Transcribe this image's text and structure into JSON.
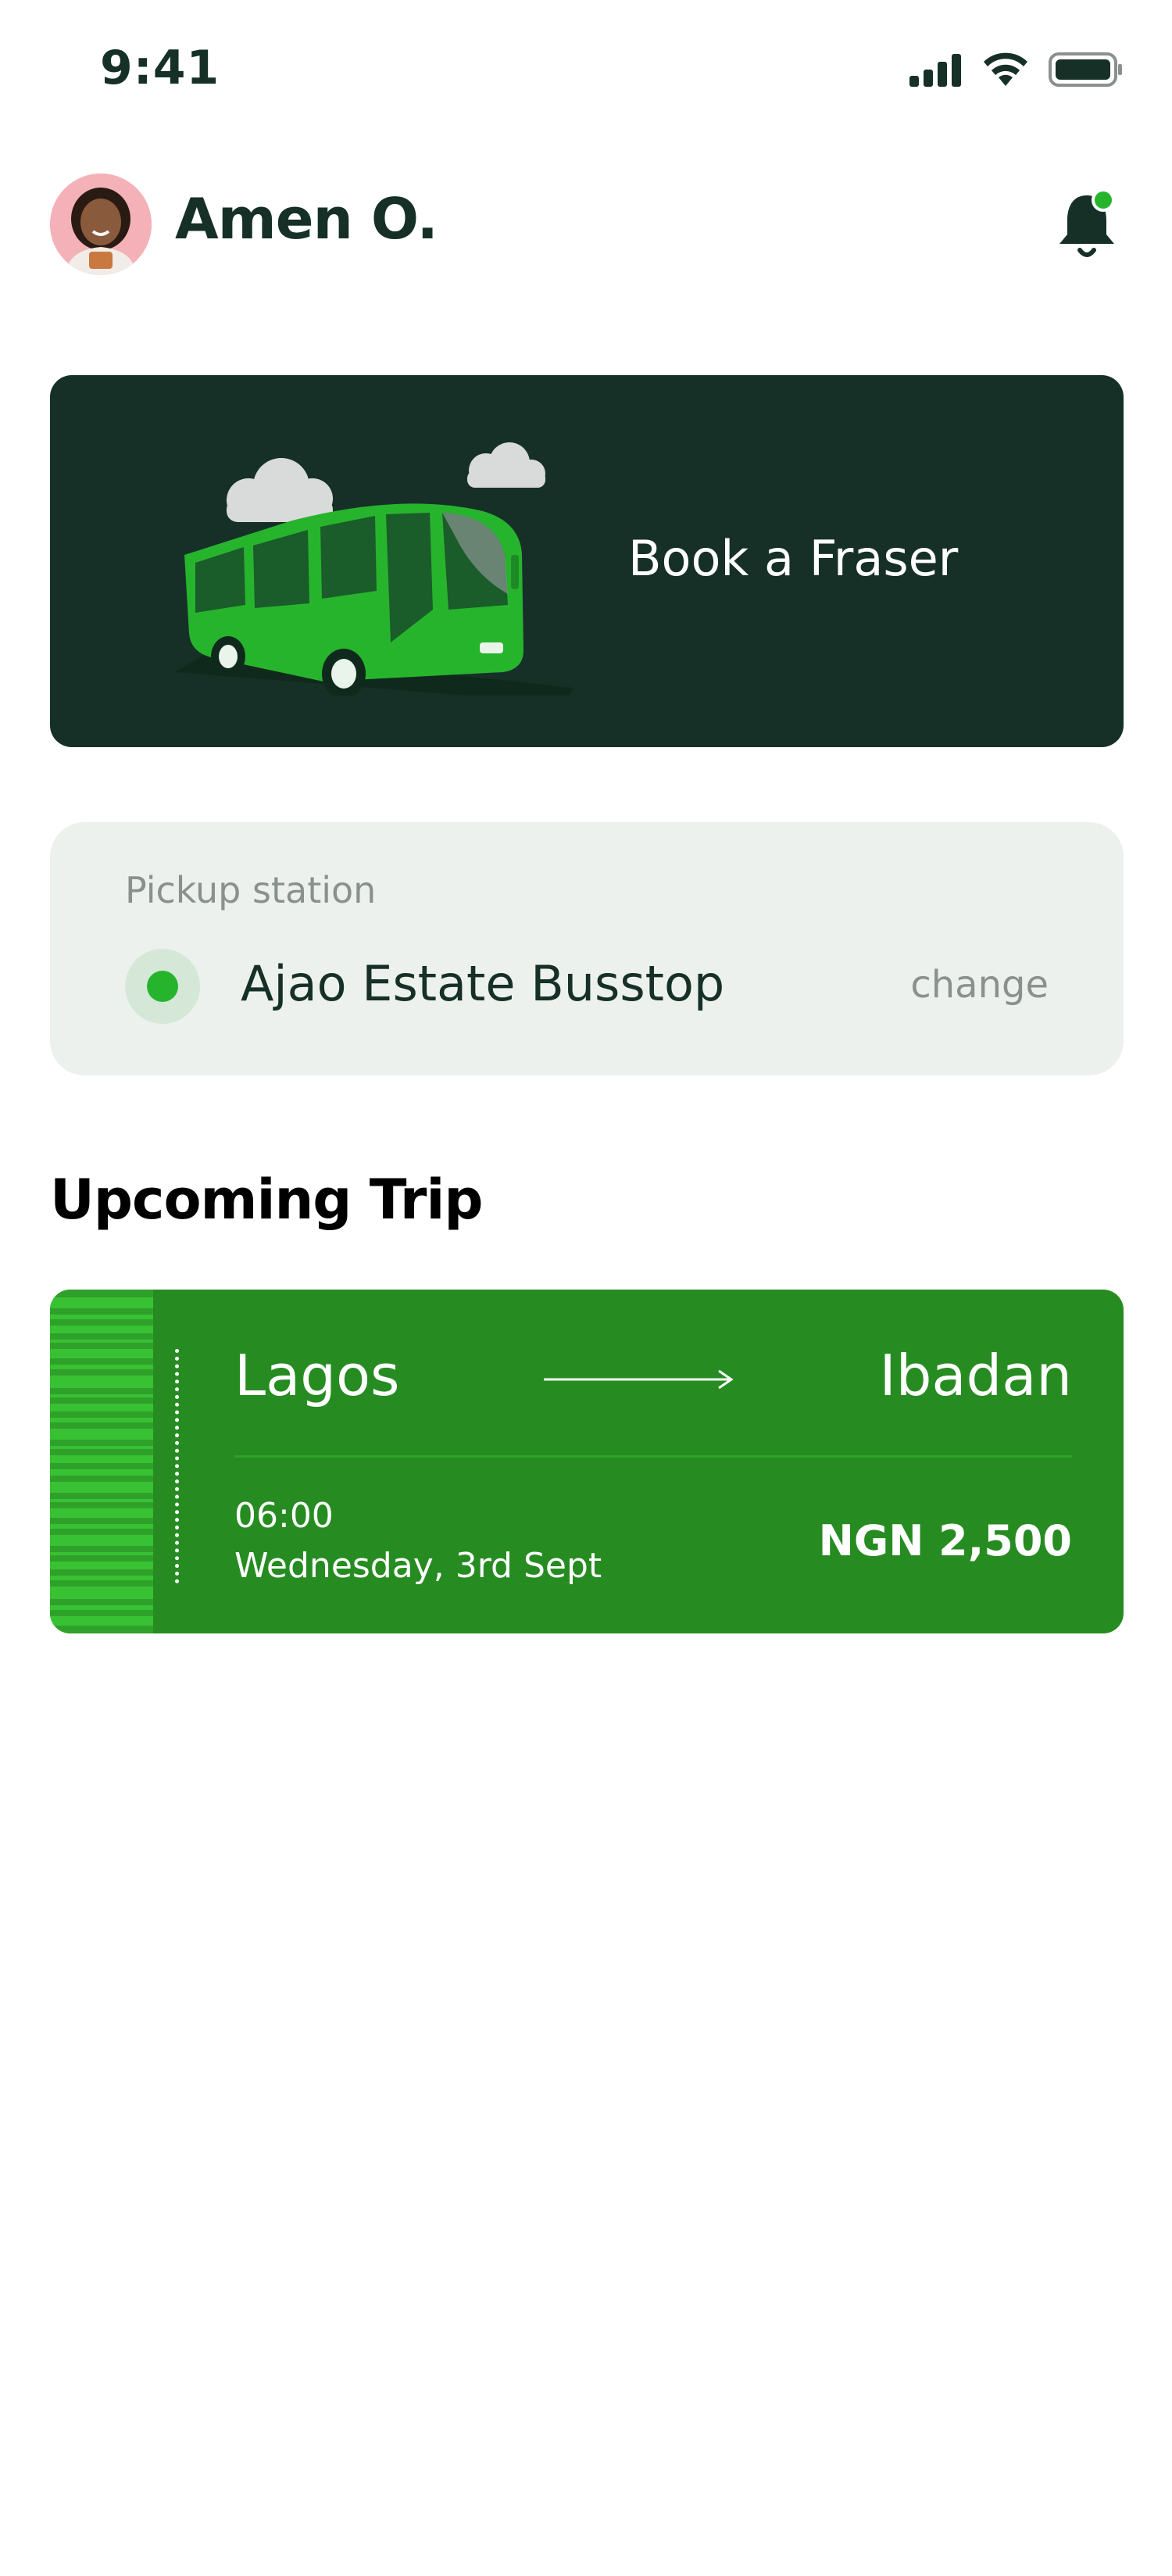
{
  "status_bar": {
    "time": "9:41",
    "icons": [
      "cellular-signal-icon",
      "wifi-icon",
      "battery-icon"
    ]
  },
  "header": {
    "user_name": "Amen O.",
    "notification_icon": "bell-icon",
    "has_notification": true
  },
  "book_banner": {
    "label": "Book a Fraser",
    "illustration": "bus-icon"
  },
  "pickup": {
    "title": "Pickup station",
    "station": "Ajao Estate Busstop",
    "change_label": "change"
  },
  "upcoming": {
    "section_title": "Upcoming Trip",
    "trip": {
      "from": "Lagos",
      "to": "Ibadan",
      "time": "06:00",
      "date": "Wednesday, 3rd Sept",
      "price": "NGN 2,500"
    }
  },
  "colors": {
    "brand_dark": "#163028",
    "brand_green": "#268c21",
    "accent_green": "#27b42d",
    "card_bg": "#edf1ee",
    "muted_text": "#8a918d"
  }
}
